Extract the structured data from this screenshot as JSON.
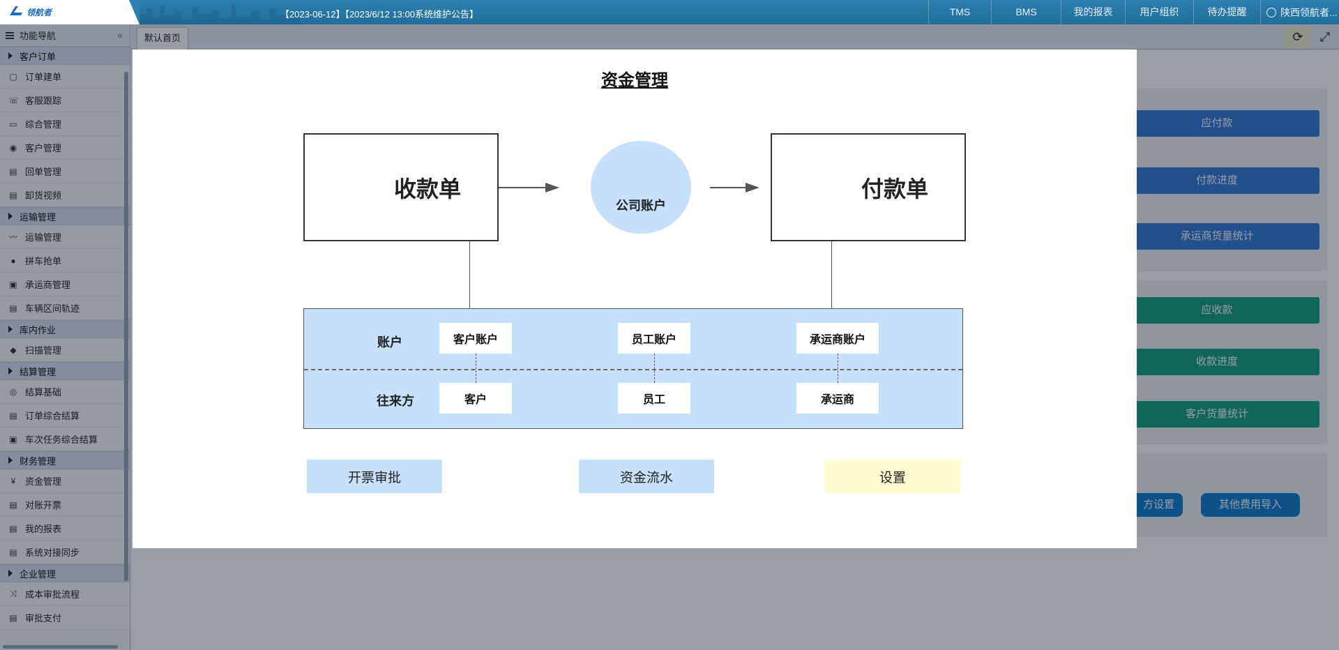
{
  "header": {
    "notice": "【2023-06-12】【2023/6/12 13:00系统维护公告】",
    "nav": [
      "TMS",
      "BMS",
      "我的报表",
      "用户组织",
      "待办提醒"
    ],
    "user": "陕西领航者..."
  },
  "sidebar": {
    "title": "功能导航",
    "groups": [
      {
        "label": "客户订单",
        "items": [
          "订单建单",
          "客服跟踪",
          "综合管理",
          "客户管理",
          "回单管理",
          "卸货视频"
        ]
      },
      {
        "label": "运输管理",
        "items": [
          "运输管理",
          "拼车抢单",
          "承运商管理",
          "车辆区间轨迹"
        ]
      },
      {
        "label": "库内作业",
        "items": [
          "扫描管理"
        ]
      },
      {
        "label": "结算管理",
        "items": [
          "结算基础",
          "订单综合结算",
          "车次任务综合结算"
        ]
      },
      {
        "label": "财务管理",
        "items": [
          "资金管理",
          "对账开票",
          "我的报表",
          "系统对接同步"
        ]
      },
      {
        "label": "企业管理",
        "items": [
          "成本审批流程",
          "审批支付"
        ]
      }
    ]
  },
  "tabs": {
    "home": "默认首页"
  },
  "background": {
    "blue_buttons": [
      "应付款",
      "付款进度",
      "承运商货量统计"
    ],
    "green_buttons": [
      "应收款",
      "收款进度",
      "客户货量统计"
    ],
    "bottom_buttons": [
      "方设置",
      "其他费用导入"
    ]
  },
  "modal": {
    "title": "资金管理",
    "receipt": "收款单",
    "company_account": "公司账户",
    "payment": "付款单",
    "row_account": "账户",
    "row_party": "往来方",
    "accounts": [
      "客户账户",
      "员工账户",
      "承运商账户"
    ],
    "parties": [
      "客户",
      "员工",
      "承运商"
    ],
    "actions": [
      "开票审批",
      "资金流水",
      "设置"
    ]
  },
  "colors": {
    "topbar": "#2d7fb0",
    "diagram_blue": "#c7e0fb",
    "btn_blue": "#2f79d6",
    "btn_green": "#14a37b"
  }
}
